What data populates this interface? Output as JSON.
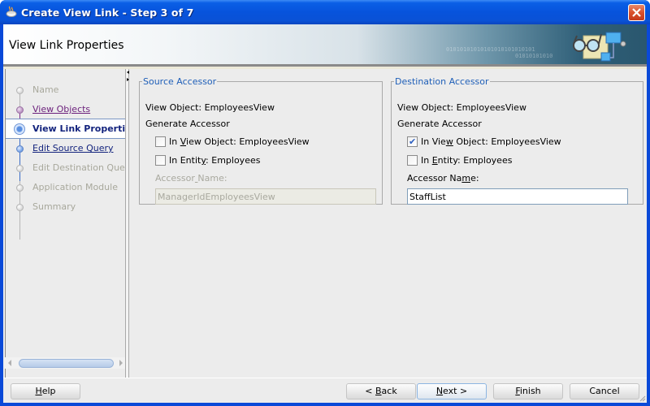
{
  "window": {
    "title": "Create View Link - Step 3 of 7",
    "app_icon": "java-cup-icon",
    "close_icon": "close-icon"
  },
  "header": {
    "title": "View Link Properties",
    "binary_text_1": "01010101010101010101010101",
    "binary_text_2": "01010101010",
    "art_icon": "view-link-glasses-icon"
  },
  "nav": {
    "items": [
      {
        "label": "Name",
        "state": "disabled"
      },
      {
        "label": "View Objects",
        "state": "visited"
      },
      {
        "label": "View Link Properties",
        "state": "current"
      },
      {
        "label": "Edit Source Query",
        "state": "link"
      },
      {
        "label": "Edit Destination Query",
        "state": "disabled"
      },
      {
        "label": "Application Module",
        "state": "disabled"
      },
      {
        "label": "Summary",
        "state": "disabled"
      }
    ]
  },
  "source": {
    "legend": "Source Accessor",
    "view_object": "View Object: EmployeesView",
    "generate": "Generate Accessor",
    "cb_view_object": {
      "pre": "In ",
      "mnemonic": "V",
      "post": "iew Object: EmployeesView",
      "checked": false
    },
    "cb_entity": {
      "pre": "In Entit",
      "mnemonic": "y",
      "post": ": Employees",
      "checked": false
    },
    "accessor_label": {
      "pre": "Accessor",
      "mnemonic": " ",
      "post": "Name:"
    },
    "accessor_value": "ManagerIdEmployeesView",
    "accessor_enabled": false
  },
  "destination": {
    "legend": "Destination Accessor",
    "view_object": "View Object: EmployeesView",
    "generate": "Generate Accessor",
    "cb_view_object": {
      "pre": "In Vie",
      "mnemonic": "w",
      "post": " Object: EmployeesView",
      "checked": true
    },
    "cb_entity": {
      "pre": "In ",
      "mnemonic": "E",
      "post": "ntity: Employees",
      "checked": false
    },
    "accessor_label": {
      "pre": "Accessor Na",
      "mnemonic": "m",
      "post": "e:"
    },
    "accessor_value": "StaffList",
    "accessor_enabled": true
  },
  "footer": {
    "help": {
      "pre": "",
      "mnemonic": "H",
      "post": "elp"
    },
    "back": {
      "pre": "< ",
      "mnemonic": "B",
      "post": "ack"
    },
    "next": {
      "pre": "",
      "mnemonic": "N",
      "post": "ext >"
    },
    "finish": {
      "pre": "",
      "mnemonic": "F",
      "post": "inish"
    },
    "cancel": {
      "pre": "Cancel",
      "mnemonic": "",
      "post": ""
    }
  }
}
